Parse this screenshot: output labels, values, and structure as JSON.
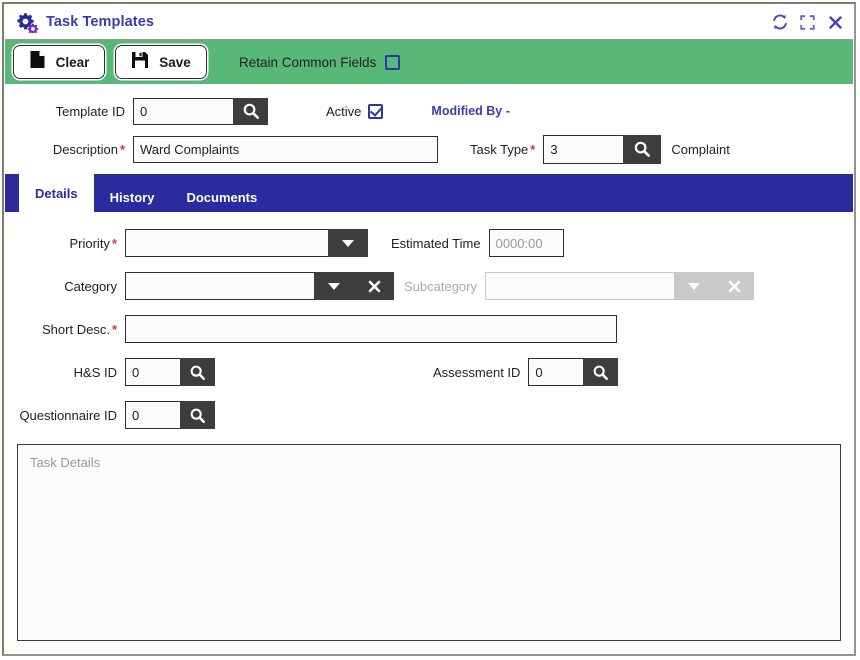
{
  "window": {
    "title": "Task Templates",
    "icon": "gears-icon",
    "actions": [
      {
        "name": "refresh-icon",
        "label": "Refresh"
      },
      {
        "name": "maximize-icon",
        "label": "Maximize"
      },
      {
        "name": "close-icon",
        "label": "Close"
      }
    ]
  },
  "toolbar": {
    "clear_label": "Clear",
    "save_label": "Save",
    "retain_label": "Retain Common Fields",
    "retain_checked": false,
    "background_color": "#57b878"
  },
  "header": {
    "template_id_label": "Template ID",
    "template_id_value": "0",
    "active_label": "Active",
    "active_checked": true,
    "modified_by": "Modified By -",
    "description_label": "Description",
    "description_required": "*",
    "description_value": "Ward Complaints",
    "task_type_label": "Task Type",
    "task_type_required": "*",
    "task_type_value": "3",
    "task_type_name": "Complaint"
  },
  "tabs": [
    {
      "label": "Details",
      "active": true
    },
    {
      "label": "History",
      "active": false
    },
    {
      "label": "Documents",
      "active": false
    }
  ],
  "details": {
    "priority_label": "Priority",
    "priority_required": "*",
    "priority_value": "",
    "estimated_time_label": "Estimated Time",
    "estimated_time_placeholder": "0000:00",
    "estimated_time_value": "",
    "category_label": "Category",
    "category_value": "",
    "subcategory_label": "Subcategory",
    "subcategory_value": "",
    "subcategory_disabled": true,
    "short_desc_label": "Short Desc.",
    "short_desc_required": "*",
    "short_desc_value": "",
    "hs_id_label": "H&S ID",
    "hs_id_value": "0",
    "assessment_id_label": "Assessment ID",
    "assessment_id_value": "0",
    "questionnaire_id_label": "Questionnaire ID",
    "questionnaire_id_value": "0",
    "task_details_placeholder": "Task Details",
    "task_details_value": ""
  },
  "colors": {
    "toolbar_green": "#57b878",
    "tab_blue": "#2b2ba0",
    "title_purple": "#3b3bb0",
    "button_dark": "#3d3d3d",
    "required_red": "#e03030"
  }
}
